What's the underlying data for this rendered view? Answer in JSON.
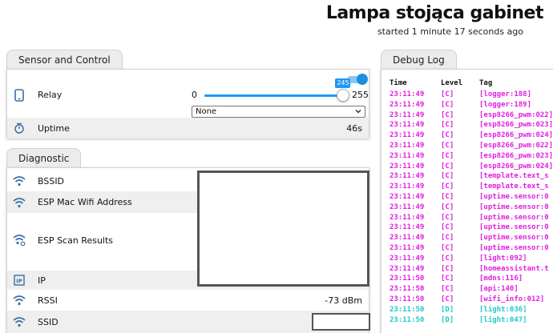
{
  "header": {
    "title": "Lampa stojąca gabinet",
    "subtitle": "started 1 minute 17 seconds ago"
  },
  "sensor_card": {
    "tab_label": "Sensor and Control",
    "relay": {
      "label": "Relay",
      "toggle_on": true,
      "slider_min": "0",
      "slider_max": "255",
      "slider_value": "245",
      "slider_level": 0.961,
      "select_value": "None"
    },
    "uptime": {
      "label": "Uptime",
      "value": "46s"
    }
  },
  "diagnostic_card": {
    "tab_label": "Diagnostic",
    "rows": [
      {
        "label": "BSSID",
        "value": ""
      },
      {
        "label": "ESP Mac Wifi Address",
        "value": ""
      },
      {
        "label": "ESP Scan Results",
        "value": ""
      },
      {
        "label": "IP",
        "value": ""
      },
      {
        "label": "RSSI",
        "value": "-73 dBm"
      },
      {
        "label": "SSID",
        "value": ""
      }
    ]
  },
  "debug_log": {
    "tab_label": "Debug Log",
    "columns": {
      "time": "Time",
      "level": "Level",
      "tag": "Tag"
    },
    "colors": {
      "C": "#e020e0",
      "D": "#20c8c8"
    },
    "lines": [
      {
        "time": "23:11:49",
        "level": "[C]",
        "tag": "[logger:188]"
      },
      {
        "time": "23:11:49",
        "level": "[C]",
        "tag": "[logger:189]"
      },
      {
        "time": "23:11:49",
        "level": "[C]",
        "tag": "[esp8266_pwm:022]"
      },
      {
        "time": "23:11:49",
        "level": "[C]",
        "tag": "[esp8266_pwm:023]"
      },
      {
        "time": "23:11:49",
        "level": "[C]",
        "tag": "[esp8266_pwm:024]"
      },
      {
        "time": "23:11:49",
        "level": "[C]",
        "tag": "[esp8266_pwm:022]"
      },
      {
        "time": "23:11:49",
        "level": "[C]",
        "tag": "[esp8266_pwm:023]"
      },
      {
        "time": "23:11:49",
        "level": "[C]",
        "tag": "[esp8266_pwm:024]"
      },
      {
        "time": "23:11:49",
        "level": "[C]",
        "tag": "[template.text_s"
      },
      {
        "time": "23:11:49",
        "level": "[C]",
        "tag": "[template.text_s"
      },
      {
        "time": "23:11:49",
        "level": "[C]",
        "tag": "[uptime.sensor:0"
      },
      {
        "time": "23:11:49",
        "level": "[C]",
        "tag": "[uptime.sensor:0"
      },
      {
        "time": "23:11:49",
        "level": "[C]",
        "tag": "[uptime.sensor:0"
      },
      {
        "time": "23:11:49",
        "level": "[C]",
        "tag": "[uptime.sensor:0"
      },
      {
        "time": "23:11:49",
        "level": "[C]",
        "tag": "[uptime.sensor:0"
      },
      {
        "time": "23:11:49",
        "level": "[C]",
        "tag": "[uptime.sensor:0"
      },
      {
        "time": "23:11:49",
        "level": "[C]",
        "tag": "[light:092]"
      },
      {
        "time": "23:11:49",
        "level": "[C]",
        "tag": "[homeassistant.t"
      },
      {
        "time": "23:11:50",
        "level": "[C]",
        "tag": "[mdns:116]"
      },
      {
        "time": "23:11:50",
        "level": "[C]",
        "tag": "[api:140]"
      },
      {
        "time": "23:11:50",
        "level": "[C]",
        "tag": "[wifi_info:012]"
      },
      {
        "time": "23:11:50",
        "level": "[D]",
        "tag": "[light:036]"
      },
      {
        "time": "23:11:50",
        "level": "[D]",
        "tag": "[light:047]"
      }
    ]
  }
}
